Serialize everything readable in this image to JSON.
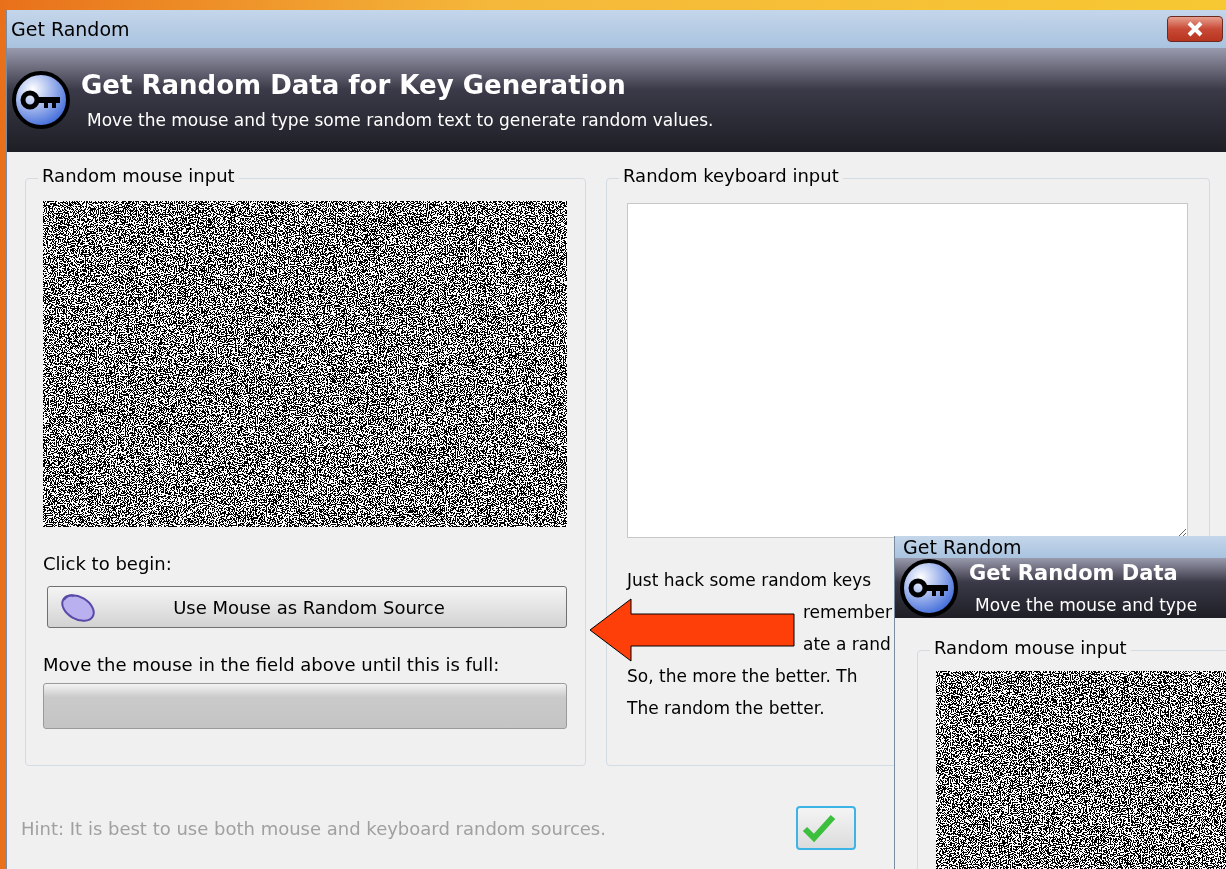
{
  "window": {
    "title": "Get Random"
  },
  "header": {
    "title": "Get Random Data for Key Generation",
    "subtitle": "Move the mouse and type some random text to generate random values."
  },
  "mouse_group": {
    "title": "Random mouse input",
    "prompt": "Click to begin:",
    "button": "Use Mouse as Random Source",
    "progress_label": "Move the mouse in the field above until this is full:",
    "progress": {
      "level": 0
    }
  },
  "keyboard_group": {
    "title": "Random keyboard input",
    "lines": [
      {
        "text": "Just hack some random keys",
        "kind": "full"
      },
      {
        "text": "remember",
        "kind": "covered"
      },
      {
        "text": "ate a rand",
        "kind": "covered"
      },
      {
        "text": "So, the more the better. Th",
        "kind": "full"
      },
      {
        "text": "The random the better.",
        "kind": "full"
      }
    ]
  },
  "hint": "Hint: It is best to use both mouse and keyboard random sources.",
  "second_window": {
    "title": "Get Random",
    "header_title": "Get Random Data",
    "header_subtitle": "Move the mouse and type",
    "group_title": "Random mouse input"
  }
}
